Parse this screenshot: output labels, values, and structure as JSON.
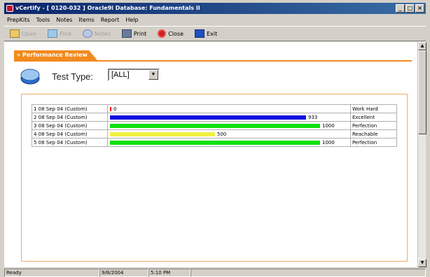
{
  "window": {
    "title": "vCertify - [ 0120-032 ] Oracle9i Database: Fundamentals II",
    "min_glyph": "_",
    "max_glyph": "□",
    "close_glyph": "×"
  },
  "menu": [
    "PrepKits",
    "Tools",
    "Notes",
    "Items",
    "Report",
    "Help"
  ],
  "toolbar": [
    {
      "label": "Open",
      "icon": "open-folder-icon",
      "enabled": false
    },
    {
      "label": "Find",
      "icon": "find-icon",
      "enabled": false
    },
    {
      "label": "Notes",
      "icon": "notes-icon",
      "enabled": false
    },
    {
      "label": "Print",
      "icon": "printer-icon",
      "enabled": true
    },
    {
      "label": "Close",
      "icon": "close-circle-icon",
      "enabled": true
    },
    {
      "label": "Exit",
      "icon": "exit-door-icon",
      "enabled": true
    }
  ],
  "section": {
    "title": "» Performance Review"
  },
  "test_type": {
    "label": "Test Type:",
    "value": "[ALL]"
  },
  "results": {
    "max_value": 1000,
    "rows": [
      {
        "label": "1 08 Sep 04 (Custom)",
        "value": 0,
        "value_text": "0",
        "color": "#ff0000",
        "rating": "Work Hard"
      },
      {
        "label": "2 08 Sep 04 (Custom)",
        "value": 933,
        "value_text": "933",
        "color": "#1010e0",
        "rating": "Excellent"
      },
      {
        "label": "3 08 Sep 04 (Custom)",
        "value": 1000,
        "value_text": "1000",
        "color": "#10e010",
        "rating": "Perfection"
      },
      {
        "label": "4 08 Sep 04 (Custom)",
        "value": 500,
        "value_text": "500",
        "color": "#f0f040",
        "rating": "Reachable"
      },
      {
        "label": "5 08 Sep 04 (Custom)",
        "value": 1000,
        "value_text": "1000",
        "color": "#10e010",
        "rating": "Perfection"
      }
    ]
  },
  "status": {
    "state": "Ready",
    "date": "9/8/2004",
    "time": "5:10 PM"
  }
}
